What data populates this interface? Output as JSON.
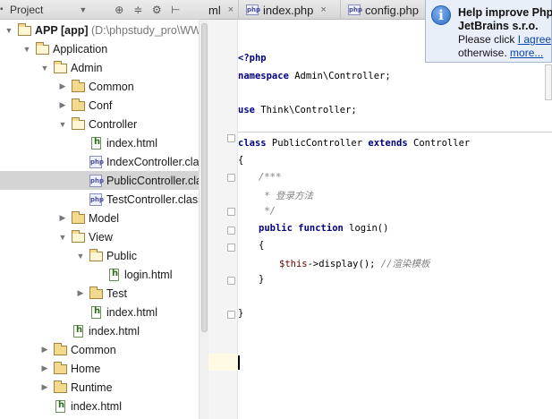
{
  "project_panel": {
    "title": "Project",
    "tools": [
      "⊕",
      "≑",
      "⚙",
      "⊢"
    ]
  },
  "tree": [
    {
      "depth": 0,
      "arrow": "open",
      "icon": "folder",
      "label_bold": "APP [app]",
      "label_path": " (D:\\phpstudy_pro\\WW"
    },
    {
      "depth": 1,
      "arrow": "open",
      "icon": "folder",
      "label": "Application"
    },
    {
      "depth": 2,
      "arrow": "open",
      "icon": "folder",
      "label": "Admin"
    },
    {
      "depth": 3,
      "arrow": "closed",
      "icon": "folder",
      "label": "Common"
    },
    {
      "depth": 3,
      "arrow": "closed",
      "icon": "folder",
      "label": "Conf"
    },
    {
      "depth": 3,
      "arrow": "open",
      "icon": "folder",
      "label": "Controller"
    },
    {
      "depth": 4,
      "arrow": "none",
      "icon": "html",
      "label": "index.html"
    },
    {
      "depth": 4,
      "arrow": "none",
      "icon": "php",
      "label": "IndexController.clas"
    },
    {
      "depth": 4,
      "arrow": "none",
      "icon": "php",
      "label": "PublicController.cla",
      "selected": true
    },
    {
      "depth": 4,
      "arrow": "none",
      "icon": "php",
      "label": "TestController.class"
    },
    {
      "depth": 3,
      "arrow": "closed",
      "icon": "folder",
      "label": "Model"
    },
    {
      "depth": 3,
      "arrow": "open",
      "icon": "folder",
      "label": "View"
    },
    {
      "depth": 4,
      "arrow": "open",
      "icon": "folder",
      "label": "Public"
    },
    {
      "depth": 5,
      "arrow": "none",
      "icon": "html",
      "label": "login.html"
    },
    {
      "depth": 4,
      "arrow": "closed",
      "icon": "folder",
      "label": "Test"
    },
    {
      "depth": 4,
      "arrow": "none",
      "icon": "html",
      "label": "index.html"
    },
    {
      "depth": 3,
      "arrow": "none",
      "icon": "html",
      "label": "index.html"
    },
    {
      "depth": 2,
      "arrow": "closed",
      "icon": "folder",
      "label": "Common"
    },
    {
      "depth": 2,
      "arrow": "closed",
      "icon": "folder",
      "label": "Home"
    },
    {
      "depth": 2,
      "arrow": "closed",
      "icon": "folder",
      "label": "Runtime"
    },
    {
      "depth": 2,
      "arrow": "none",
      "icon": "html",
      "label": "index.html"
    }
  ],
  "tabs": [
    {
      "label": "ml",
      "close": "×"
    },
    {
      "label": "index.php",
      "close": "×",
      "icon": "php"
    },
    {
      "label": "config.php",
      "close": "",
      "icon": "php"
    }
  ],
  "notification": {
    "line1": "Help improve Php",
    "line2": "JetBrains s.r.o.",
    "line3_prefix": "Please click ",
    "line3_link": "I agree",
    "line4_prefix": "otherwise. ",
    "line4_link": "more..."
  },
  "code": {
    "l1": "<?php",
    "l2_kw": "namespace",
    "l2_rest": " Admin\\Controller;",
    "l3_kw": "use",
    "l3_rest": " Think\\Controller;",
    "l4_kw1": "class",
    "l4_mid": " PublicController ",
    "l4_kw2": "extends",
    "l4_rest": " Controller",
    "l5": "{",
    "l6": "/***",
    "l7": " * 登录方法",
    "l8": " */",
    "l9_kw1": "public",
    "l9_kw2": "function",
    "l9_rest": " login()",
    "l10": "{",
    "l11_var": "$this",
    "l11_rest": "->display(); ",
    "l11_cm": "//渲染模板",
    "l12": "}",
    "l13": "}"
  }
}
